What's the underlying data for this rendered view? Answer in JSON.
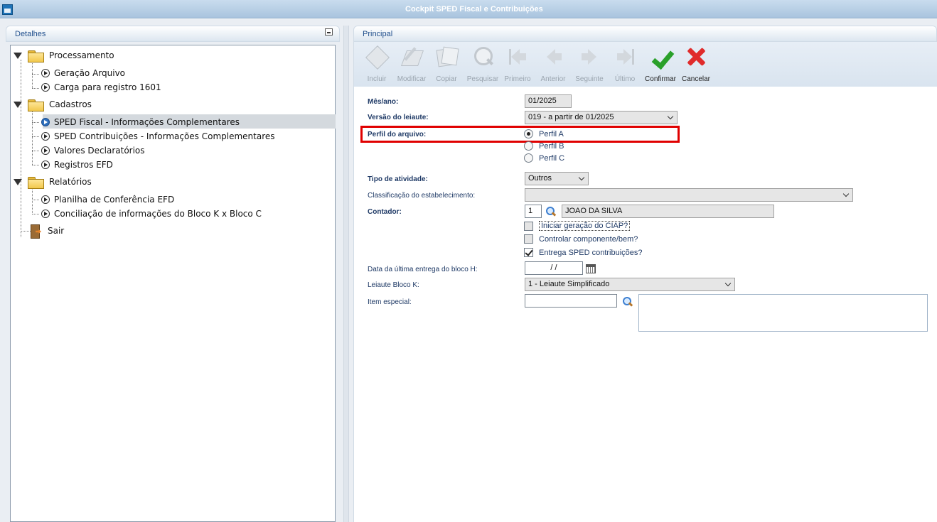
{
  "window": {
    "title": "Cockpit SPED Fiscal e Contribuições"
  },
  "left_panel": {
    "header": "Detalhes",
    "tree": [
      {
        "id": "processamento",
        "label": "Processamento"
      },
      {
        "id": "geracao-arquivo",
        "label": "Geração Arquivo"
      },
      {
        "id": "carga-registro",
        "label": "Carga para registro 1601"
      },
      {
        "id": "cadastros",
        "label": "Cadastros"
      },
      {
        "id": "sped-fiscal",
        "label": "SPED Fiscal - Informações Complementares"
      },
      {
        "id": "sped-contribuicoes",
        "label": "SPED Contribuições - Informações Complementares"
      },
      {
        "id": "valores-declaratorios",
        "label": "Valores Declaratórios"
      },
      {
        "id": "registros-efd",
        "label": "Registros EFD"
      },
      {
        "id": "relatorios",
        "label": "Relatórios"
      },
      {
        "id": "planilha-conferencia",
        "label": "Planilha de Conferência EFD"
      },
      {
        "id": "conciliacao-bloco-k",
        "label": "Conciliação de informações do Bloco K x Bloco C"
      },
      {
        "id": "sair",
        "label": "Sair"
      }
    ],
    "selected": "SPED Fiscal - Informações Complementares"
  },
  "right_panel": {
    "header": "Principal",
    "toolbar": [
      {
        "label": "Incluir",
        "icon": "add-diamond-icon",
        "enabled": false
      },
      {
        "label": "Modificar",
        "icon": "edit-pencil-icon",
        "enabled": false
      },
      {
        "label": "Copiar",
        "icon": "copy-icon",
        "enabled": false
      },
      {
        "label": "Pesquisar",
        "icon": "search-icon",
        "enabled": false
      },
      {
        "label": "Primeiro",
        "icon": "first-arrow-icon",
        "enabled": false
      },
      {
        "label": "Anterior",
        "icon": "previous-arrow-icon",
        "enabled": false
      },
      {
        "label": "Seguinte",
        "icon": "next-arrow-icon",
        "enabled": false
      },
      {
        "label": "Último",
        "icon": "last-arrow-icon",
        "enabled": false
      },
      {
        "label": "Confirmar",
        "icon": "confirm-check-icon",
        "enabled": true
      },
      {
        "label": "Cancelar",
        "icon": "cancel-x-icon",
        "enabled": true
      }
    ],
    "form": {
      "mes_ano": {
        "label": "Mês/ano:",
        "value": "01/2025"
      },
      "versao_leiaute": {
        "label": "Versão do leiaute:",
        "value": "019 - a partir de 01/2025"
      },
      "perfil_arquivo": {
        "label": "Perfil do arquivo:",
        "options": [
          "Perfil A",
          "Perfil B",
          "Perfil C"
        ],
        "selected": "Perfil A"
      },
      "tipo_atividade": {
        "label": "Tipo de atividade:",
        "value": "Outros"
      },
      "classificacao": {
        "label": "Classificação do estabelecimento:",
        "value": ""
      },
      "contador": {
        "label": "Contador:",
        "code": "1",
        "name": "JOAO DA SILVA"
      },
      "checkboxes": [
        {
          "label": "Iniciar geração do CIAP?",
          "checked": false
        },
        {
          "label": "Controlar componente/bem?",
          "checked": false
        },
        {
          "label": "Entrega SPED contribuições?",
          "checked": true
        }
      ],
      "data_ultima_entrega": {
        "label": "Data da última entrega do bloco H:",
        "value": "/ /"
      },
      "leiaute_bloco_k": {
        "label": "Leiaute Bloco K:",
        "value": "1 - Leiaute Simplificado"
      },
      "item_especial": {
        "label": "Item especial:",
        "value": "",
        "description": ""
      }
    },
    "highlight_color": "#e00000"
  }
}
